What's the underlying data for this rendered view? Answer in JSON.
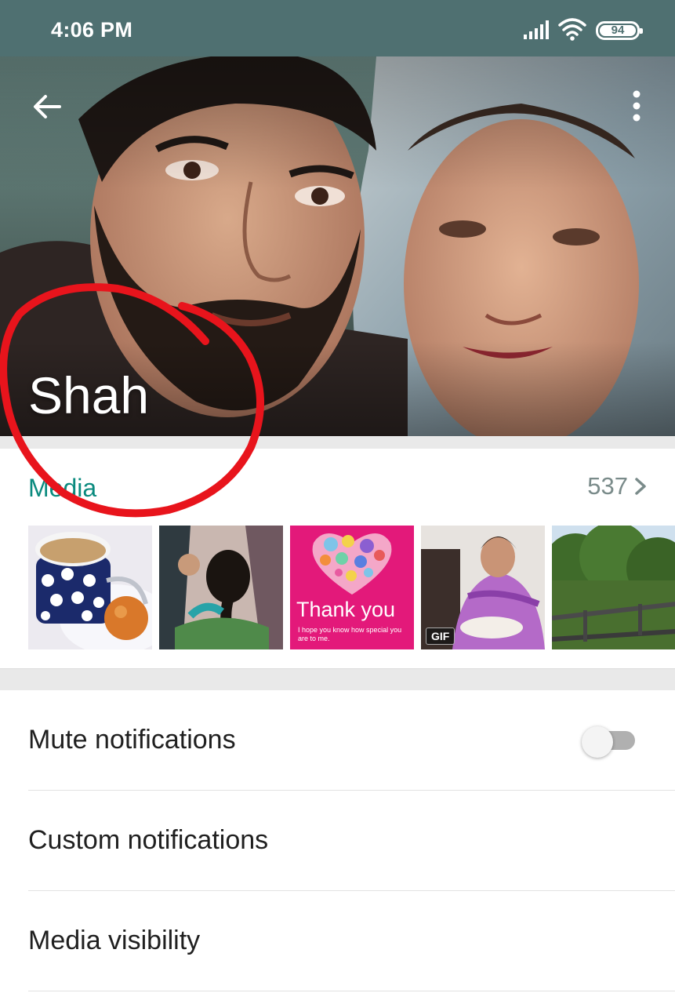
{
  "status_bar": {
    "time": "4:06 PM",
    "battery_level": "94",
    "icons": [
      "signal-icon",
      "wifi-icon",
      "battery-icon"
    ]
  },
  "header": {
    "name": "Shah",
    "back_icon": "arrow-left-icon",
    "menu_icon": "more-vert-icon"
  },
  "media": {
    "title": "Media",
    "count": "537",
    "chevron_icon": "chevron-right-icon",
    "thumbnails": [
      {
        "kind": "image"
      },
      {
        "kind": "image"
      },
      {
        "kind": "image",
        "caption": "Thank you",
        "subcaption": "I hope you know how special you are to me."
      },
      {
        "kind": "gif",
        "badge": "GIF"
      },
      {
        "kind": "image"
      }
    ]
  },
  "settings": {
    "mute_notifications": {
      "label": "Mute notifications",
      "enabled": false
    },
    "custom_notifications": {
      "label": "Custom notifications"
    },
    "media_visibility": {
      "label": "Media visibility"
    }
  },
  "colors": {
    "status_bar": "#4f7071",
    "accent": "#0a8a7e",
    "annotation": "#e8141c"
  }
}
